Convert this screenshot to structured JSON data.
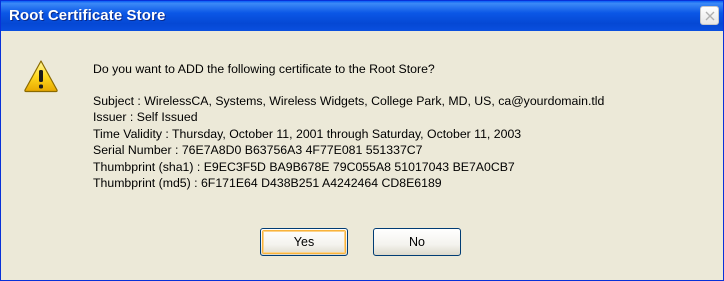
{
  "window": {
    "title": "Root Certificate Store",
    "titlebar_color": "#0548d4"
  },
  "icons": {
    "message_icon": "warning-icon",
    "close_icon": "close-icon"
  },
  "message": {
    "question": "Do you want to ADD the following certificate to the Root Store?",
    "details": [
      "Subject : WirelessCA, Systems, Wireless Widgets, College Park, MD, US, ca@yourdomain.tld",
      "Issuer : Self Issued",
      "Time Validity : Thursday, October 11, 2001 through Saturday, October 11, 2003",
      "Serial Number : 76E7A8D0 B63756A3 4F77E081 551337C7",
      "Thumbprint (sha1) : E9EC3F5D BA9B678E 79C055A8 51017043 BE7A0CB7",
      "Thumbprint (md5) : 6F171E64 D438B251 A4242464 CD8E6189"
    ]
  },
  "buttons": {
    "yes_label": "Yes",
    "no_label": "No"
  }
}
